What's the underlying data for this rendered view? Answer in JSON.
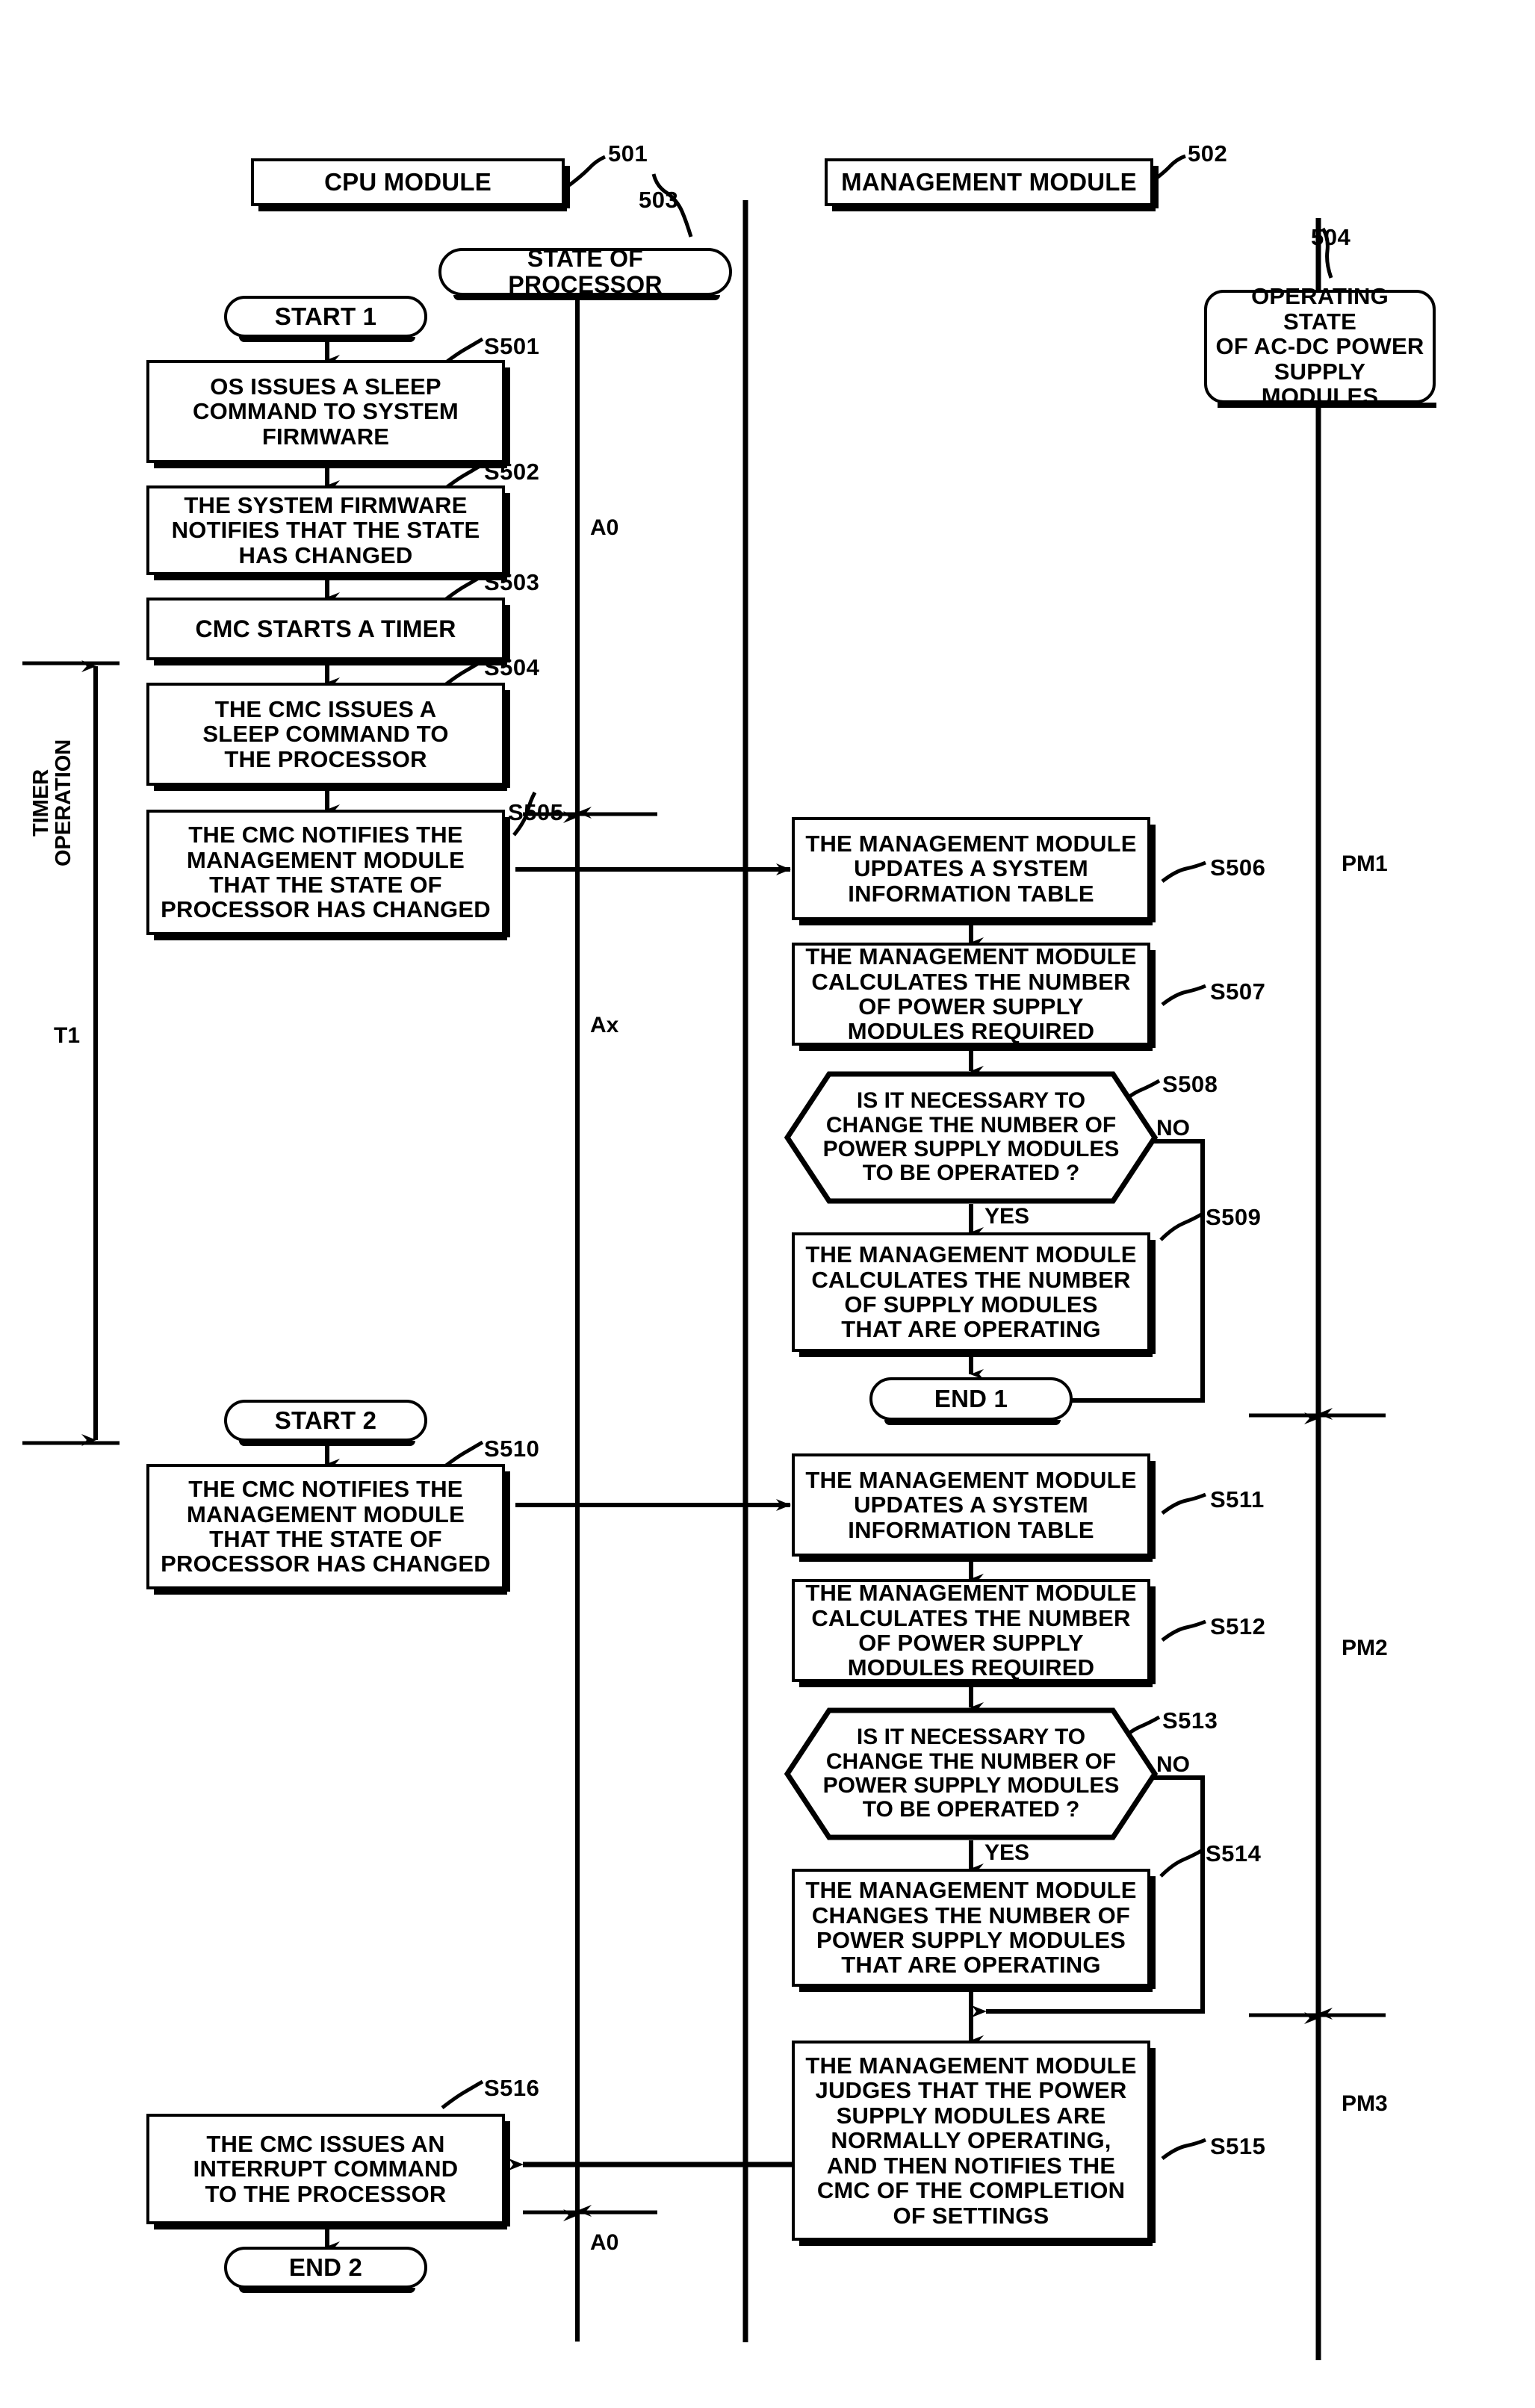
{
  "figure": {
    "kind": "patent-flowchart",
    "swimlanes": [
      {
        "id": "cpu",
        "title": "CPU MODULE",
        "ref": "501"
      },
      {
        "id": "mgmt",
        "title": "MANAGEMENT MODULE",
        "ref": "502"
      }
    ],
    "timelines": [
      {
        "id": "state_of_processor",
        "title": "STATE OF PROCESSOR",
        "ref": "503"
      },
      {
        "id": "acdc_state",
        "title": "OPERATING STATE\nOF AC-DC POWER\nSUPPLY MODULES",
        "ref": "504"
      }
    ]
  },
  "cpu_lane": {
    "start1": "START 1",
    "start2": "START 2",
    "end2": "END 2",
    "steps": [
      {
        "id": "S501",
        "text": "OS ISSUES A SLEEP\nCOMMAND TO SYSTEM\nFIRMWARE"
      },
      {
        "id": "S502",
        "text": "THE SYSTEM FIRMWARE\nNOTIFIES THAT THE STATE\nHAS CHANGED"
      },
      {
        "id": "S503",
        "text": "CMC STARTS A TIMER"
      },
      {
        "id": "S504",
        "text": "THE CMC ISSUES A\nSLEEP COMMAND TO\nTHE PROCESSOR"
      },
      {
        "id": "S505",
        "text": "THE CMC NOTIFIES THE\nMANAGEMENT MODULE\nTHAT THE STATE OF\nPROCESSOR HAS CHANGED"
      },
      {
        "id": "S510",
        "text": "THE CMC NOTIFIES THE\nMANAGEMENT MODULE\nTHAT THE STATE OF\nPROCESSOR HAS CHANGED"
      },
      {
        "id": "S516",
        "text": "THE CMC ISSUES AN\nINTERRUPT COMMAND\nTO THE PROCESSOR"
      }
    ]
  },
  "mgmt_lane": {
    "end1": "END 1",
    "steps": [
      {
        "id": "S506",
        "text": "THE MANAGEMENT MODULE\nUPDATES A SYSTEM\nINFORMATION TABLE"
      },
      {
        "id": "S507",
        "text": "THE MANAGEMENT MODULE\nCALCULATES THE NUMBER\nOF POWER SUPPLY\nMODULES REQUIRED"
      },
      {
        "id": "S508",
        "text": "IS IT NECESSARY TO\nCHANGE  THE NUMBER OF\nPOWER SUPPLY MODULES\nTO BE OPERATED ?",
        "type": "decision"
      },
      {
        "id": "S509",
        "text": "THE MANAGEMENT MODULE\nCALCULATES THE NUMBER\nOF SUPPLY MODULES\nTHAT ARE OPERATING"
      },
      {
        "id": "S511",
        "text": "THE MANAGEMENT MODULE\nUPDATES A SYSTEM\nINFORMATION TABLE"
      },
      {
        "id": "S512",
        "text": "THE MANAGEMENT MODULE\nCALCULATES THE NUMBER\nOF POWER SUPPLY\nMODULES  REQUIRED"
      },
      {
        "id": "S513",
        "text": "IS IT NECESSARY TO\nCHANGE  THE NUMBER OF\nPOWER SUPPLY MODULES\nTO BE OPERATED ?",
        "type": "decision"
      },
      {
        "id": "S514",
        "text": "THE MANAGEMENT MODULE\nCHANGES THE NUMBER OF\nPOWER SUPPLY MODULES\nTHAT ARE OPERATING"
      },
      {
        "id": "S515",
        "text": "THE MANAGEMENT MODULE\nJUDGES THAT THE POWER\nSUPPLY MODULES ARE\nNORMALLY OPERATING,\nAND THEN NOTIFIES THE\nCMC OF THE COMPLETION\nOF SETTINGS"
      }
    ]
  },
  "branch_labels": {
    "s508_no": "NO",
    "s508_yes": "YES",
    "s513_no": "NO",
    "s513_yes": "YES"
  },
  "annotations": {
    "timer_operation": "TIMER\nOPERATION",
    "t1": "T1",
    "a0_top": "A0",
    "ax": "Ax",
    "a0_bottom": "A0",
    "pm1": "PM1",
    "pm2": "PM2",
    "pm3": "PM3"
  },
  "colors": {
    "ink": "#000000",
    "paper": "#ffffff"
  }
}
